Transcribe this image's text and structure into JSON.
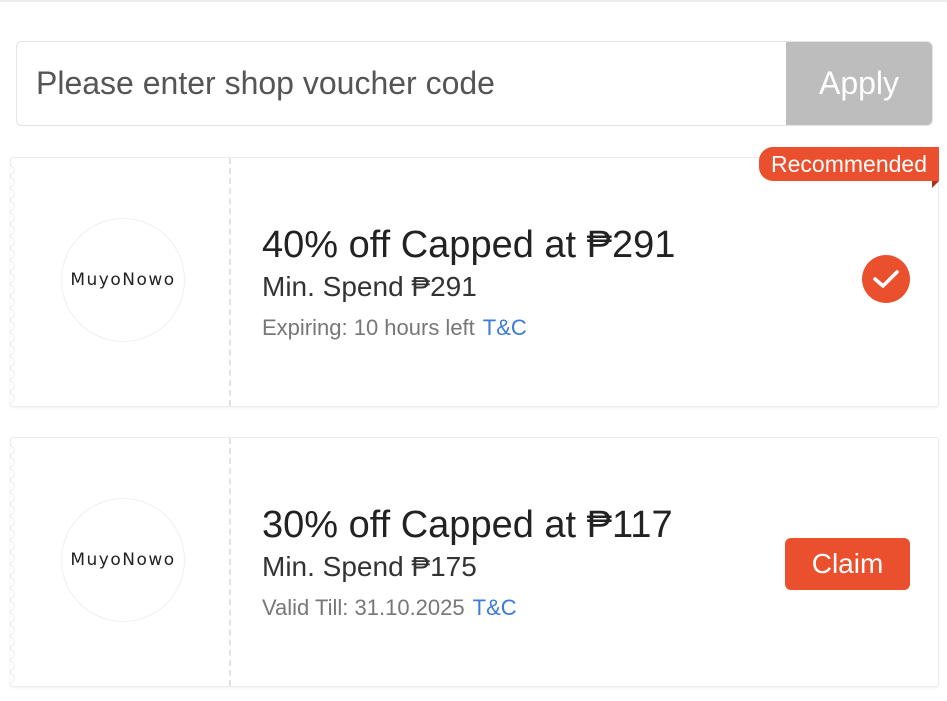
{
  "voucher_input": {
    "placeholder": "Please enter shop voucher code",
    "value": ""
  },
  "apply_label": "Apply",
  "vouchers": [
    {
      "shop_name": "MuyoNowo",
      "badge": "Recommended",
      "title": "40% off Capped at ₱291",
      "min_spend": "Min. Spend ₱291",
      "validity": "Expiring: 10 hours left",
      "tnc": "T&C",
      "state": "selected"
    },
    {
      "shop_name": "MuyoNowo",
      "title": "30% off Capped at ₱117",
      "min_spend": "Min. Spend ₱175",
      "validity": "Valid Till: 31.10.2025",
      "tnc": "T&C",
      "action_label": "Claim"
    }
  ],
  "colors": {
    "accent": "#ea4f2e",
    "link": "#3c7bd6",
    "apply_disabled": "#bdbdbd"
  },
  "icons": {
    "selected": "check-circle-icon"
  }
}
